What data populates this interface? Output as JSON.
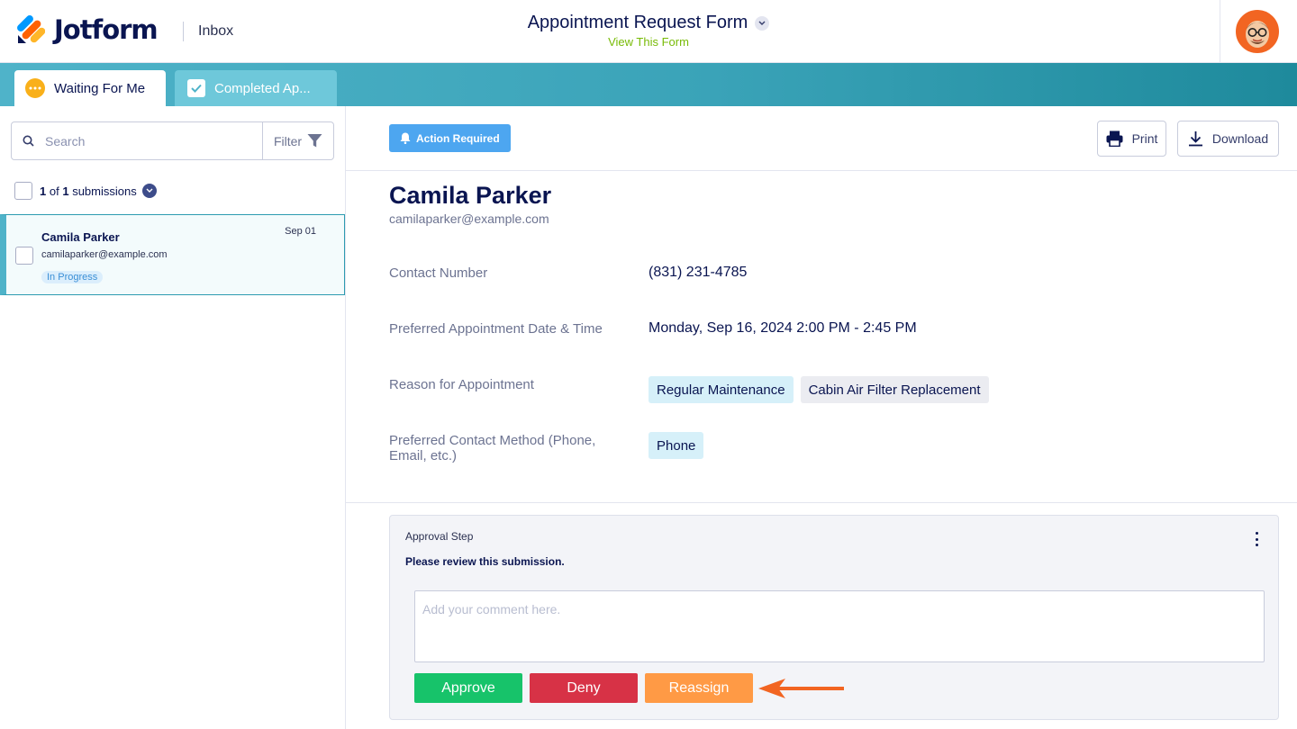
{
  "header": {
    "brand": "Jotform",
    "section": "Inbox",
    "form_title": "Appointment Request Form",
    "view_form_link": "View This Form"
  },
  "tabs": [
    {
      "label": "Waiting For Me",
      "icon": "more-dots-icon",
      "active": true
    },
    {
      "label": "Completed Ap...",
      "icon": "checkbox-checked-icon",
      "active": false
    }
  ],
  "sidebar": {
    "search_placeholder": "Search",
    "filter_label": "Filter",
    "count_current": "1",
    "count_of": "of",
    "count_total": "1",
    "count_suffix": "submissions",
    "submissions": [
      {
        "name": "Camila Parker",
        "email": "camilaparker@example.com",
        "date": "Sep 01",
        "status": "In Progress"
      }
    ]
  },
  "toolbar": {
    "action_badge": "Action Required",
    "print_label": "Print",
    "download_label": "Download"
  },
  "submission": {
    "name": "Camila Parker",
    "email": "camilaparker@example.com",
    "fields": [
      {
        "label": "Contact Number",
        "value": "(831) 231-4785"
      },
      {
        "label": "Preferred Appointment Date & Time",
        "value": "Monday, Sep 16, 2024 2:00 PM - 2:45 PM"
      },
      {
        "label": "Reason for Appointment",
        "chips": [
          "Regular Maintenance",
          "Cabin Air Filter Replacement"
        ]
      },
      {
        "label": "Preferred Contact Method (Phone, Email, etc.)",
        "chips": [
          "Phone"
        ]
      }
    ]
  },
  "approval": {
    "step_label": "Approval Step",
    "instructions": "Please review this submission.",
    "comment_placeholder": "Add your comment here.",
    "approve_label": "Approve",
    "deny_label": "Deny",
    "reassign_label": "Reassign"
  },
  "colors": {
    "brand_navy": "#0a1551",
    "tab_bar_start": "#4fb3c9",
    "tab_bar_end": "#1e8a9c",
    "approve": "#17c36a",
    "deny": "#d73246",
    "reassign": "#ff9a45",
    "action_required": "#4da6f0",
    "annotation_arrow": "#f26522"
  }
}
